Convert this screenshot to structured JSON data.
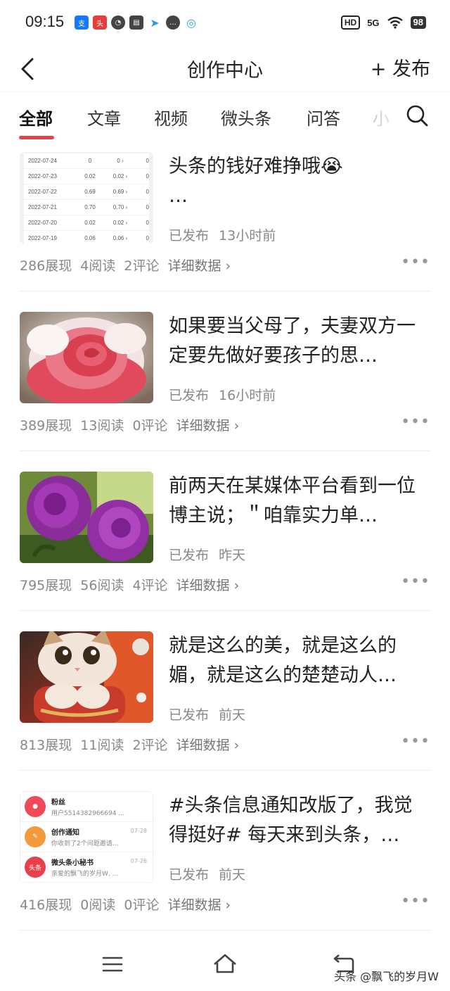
{
  "status": {
    "time": "09:15",
    "hd": "HD",
    "network": "5G",
    "battery": "98",
    "app_icons": [
      "alipay-icon",
      "toutiao-icon",
      "compass-icon",
      "calendar-icon",
      "telegram-icon",
      "chat-icon",
      "browser-icon"
    ]
  },
  "navbar": {
    "title": "创作中心",
    "publish_label": "+ 发布"
  },
  "tabs": [
    {
      "label": "全部",
      "active": true
    },
    {
      "label": "文章",
      "active": false
    },
    {
      "label": "视频",
      "active": false
    },
    {
      "label": "微头条",
      "active": false
    },
    {
      "label": "问答",
      "active": false
    },
    {
      "label": "小",
      "active": false
    }
  ],
  "posts": [
    {
      "title": "头条的钱好难挣哦😭\n…",
      "status": "已发布",
      "time": "13小时前",
      "views": "286展现",
      "reads": "4阅读",
      "comments": "2评论",
      "detail": "详细数据 ›",
      "thumb_table": [
        [
          "2022-07-24",
          "0",
          "0 ›",
          "0"
        ],
        [
          "2022-07-23",
          "0.02",
          "0.02 ›",
          "0"
        ],
        [
          "2022-07-22",
          "0.69",
          "0.69 ›",
          "0"
        ],
        [
          "2022-07-21",
          "0.70",
          "0.70 ›",
          "0"
        ],
        [
          "2022-07-20",
          "0.02",
          "0.02 ›",
          "0"
        ],
        [
          "2022-07-19",
          "0.06",
          "0.06 ›",
          "0"
        ]
      ]
    },
    {
      "title": "如果要当父母了，夫妻双方一定要先做好要孩子的思…",
      "status": "已发布",
      "time": "16小时前",
      "views": "389展现",
      "reads": "13阅读",
      "comments": "0评论",
      "detail": "详细数据 ›"
    },
    {
      "title": "前两天在某媒体平台看到一位博主说；＂咱靠实力单…",
      "status": "已发布",
      "time": "昨天",
      "views": "795展现",
      "reads": "56阅读",
      "comments": "4评论",
      "detail": "详细数据 ›"
    },
    {
      "title": "就是这么的美，就是这么的媚，就是这么的楚楚动人…",
      "status": "已发布",
      "time": "前天",
      "views": "813展现",
      "reads": "11阅读",
      "comments": "2评论",
      "detail": "详细数据 ›"
    },
    {
      "title": "#头条信息通知改版了，我觉得挺好# 每天来到头条，…",
      "status": "已发布",
      "time": "前天",
      "views": "416展现",
      "reads": "0阅读",
      "comments": "0评论",
      "detail": "详细数据 ›",
      "thumb_notifs": [
        {
          "title": "粉丝",
          "sub": "用户5514382966694 …",
          "date": ""
        },
        {
          "title": "创作通知",
          "sub": "你收到了2个问题邀请…",
          "date": "07-28"
        },
        {
          "title": "微头条小秘书",
          "sub": "亲爱的飘飞的岁月W, …",
          "date": "07-26"
        }
      ]
    }
  ],
  "more_label": "•••",
  "watermark": "头条 @飘飞的岁月W",
  "colors": {
    "accent": "#e8404a",
    "text_primary": "#222222",
    "text_secondary": "#888888"
  }
}
